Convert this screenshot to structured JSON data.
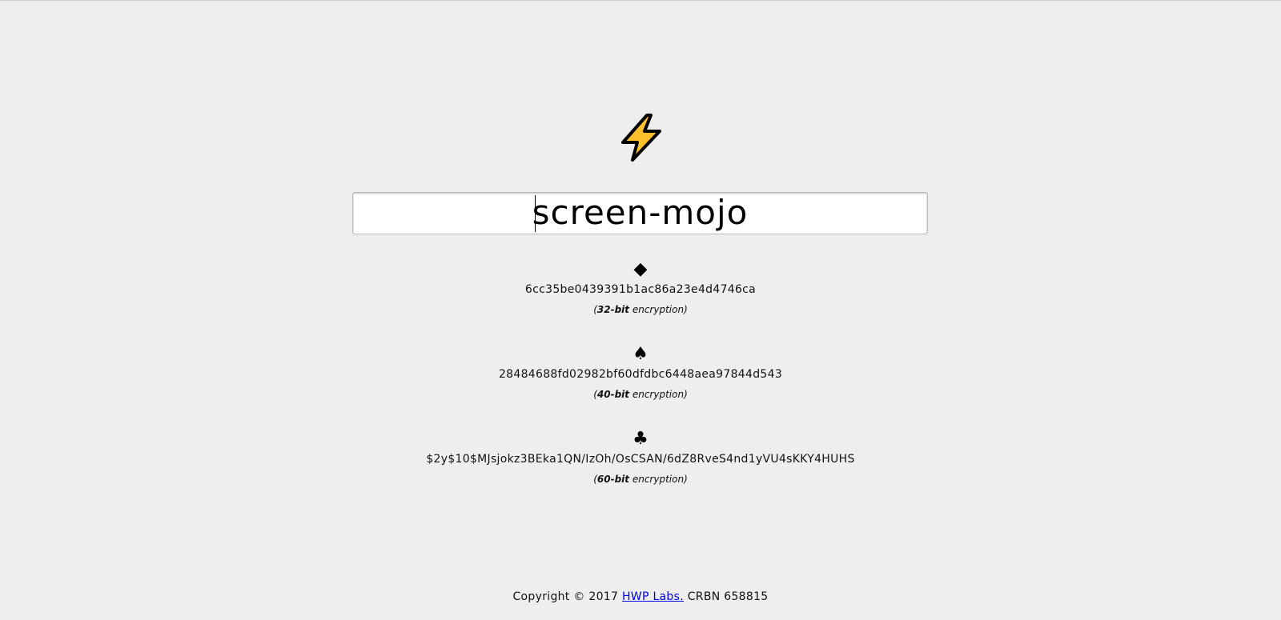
{
  "logo": {
    "icon": "lightning-bolt-icon",
    "fill": "#fcc02f",
    "stroke": "#000000"
  },
  "input": {
    "value": "screen-mojo",
    "placeholder": ""
  },
  "results": [
    {
      "suit_icon": "diamond-icon",
      "glyph": "◆",
      "hash": "6cc35be0439391b1ac86a23e4d4746ca",
      "open": "(",
      "bits": "32-bit",
      "label": " encryption)"
    },
    {
      "suit_icon": "spade-icon",
      "glyph": "♠",
      "hash": "28484688fd02982bf60dfdbc6448aea97844d543",
      "open": "(",
      "bits": "40-bit",
      "label": " encryption)"
    },
    {
      "suit_icon": "club-icon",
      "glyph": "♣",
      "hash": "$2y$10$MJsjokz3BEka1QN/IzOh/OsCSAN/6dZ8RveS4nd1yVU4sKKY4HUHS",
      "open": "(",
      "bits": "60-bit",
      "label": " encryption)"
    }
  ],
  "footer": {
    "prefix": "Copyright © 2017 ",
    "link": "HWP Labs.",
    "suffix": " CRBN 658815"
  }
}
